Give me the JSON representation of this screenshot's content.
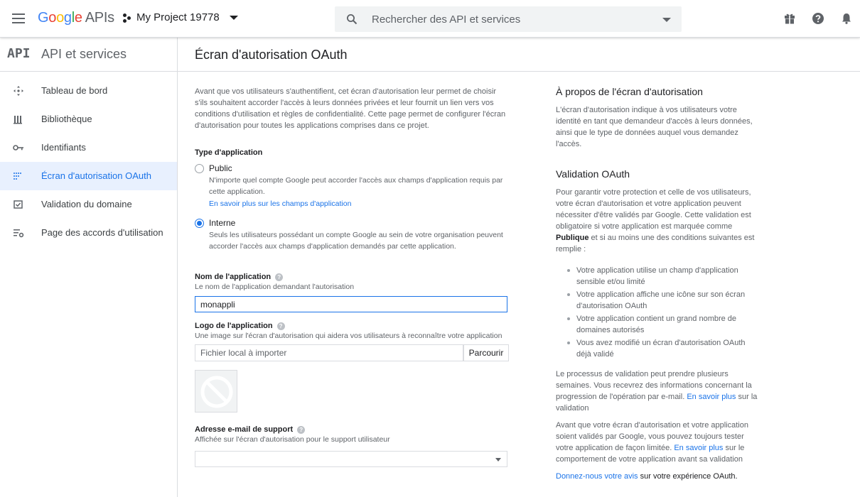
{
  "header": {
    "logo_google": [
      "G",
      "o",
      "o",
      "g",
      "l",
      "e"
    ],
    "logo_apis": "APIs",
    "project_name": "My Project 19778",
    "search_placeholder": "Rechercher des API et services",
    "icons": [
      "menu-icon",
      "project-icon",
      "search-icon",
      "gift-icon",
      "help-icon",
      "notifications-icon"
    ]
  },
  "sidebar": {
    "badge": "API",
    "title": "API et services",
    "items": [
      {
        "label": "Tableau de bord",
        "icon": "dashboard-icon"
      },
      {
        "label": "Bibliothèque",
        "icon": "library-icon"
      },
      {
        "label": "Identifiants",
        "icon": "key-icon"
      },
      {
        "label": "Écran d'autorisation OAuth",
        "icon": "oauth-consent-icon",
        "active": true
      },
      {
        "label": "Validation du domaine",
        "icon": "domain-verification-icon"
      },
      {
        "label": "Page des accords d'utilisation",
        "icon": "agreements-icon"
      }
    ]
  },
  "main": {
    "title": "Écran d'autorisation OAuth",
    "intro": "Avant que vos utilisateurs s'authentifient, cet écran d'autorisation leur permet de choisir s'ils souhaitent accorder l'accès à leurs données privées et leur fournit un lien vers vos conditions d'utilisation et règles de confidentialité. Cette page permet de configurer l'écran d'autorisation pour toutes les applications comprises dans ce projet.",
    "app_type": {
      "label": "Type d'application",
      "public_title": "Public",
      "public_desc": "N'importe quel compte Google peut accorder l'accès aux champs d'application requis par cette application.",
      "public_link": "En savoir plus sur les champs d'application",
      "internal_title": "Interne",
      "internal_desc": "Seuls les utilisateurs possédant un compte Google au sein de votre organisation peuvent accorder l'accès aux champs d'application demandés par cette application.",
      "selected": "Interne"
    },
    "app_name": {
      "label": "Nom de l'application",
      "desc": "Le nom de l'application demandant l'autorisation",
      "value": "monappli"
    },
    "app_logo": {
      "label": "Logo de l'application",
      "desc": "Une image sur l'écran d'autorisation qui aidera vos utilisateurs à reconnaître votre application",
      "file_placeholder": "Fichier local à importer",
      "browse_label": "Parcourir"
    },
    "support_email": {
      "label": "Adresse e-mail de support",
      "desc": "Affichée sur l'écran d'autorisation pour le support utilisateur",
      "value": ""
    }
  },
  "aside": {
    "about_title": "À propos de l'écran d'autorisation",
    "about_text": "L'écran d'autorisation indique à vos utilisateurs votre identité en tant que demandeur d'accès à leurs données, ainsi que le type de données auquel vous demandez l'accès.",
    "validation_title": "Validation OAuth",
    "validation_text_1": "Pour garantir votre protection et celle de vos utilisateurs, votre écran d'autorisation et votre application peuvent nécessiter d'être validés par Google. Cette validation est obligatoire si votre application est marquée comme ",
    "validation_bold": "Publique",
    "validation_text_2": " et si au moins une des conditions suivantes est remplie :",
    "conditions": [
      "Votre application utilise un champ d'application sensible et/ou limité",
      "Votre application affiche une icône sur son écran d'autorisation OAuth",
      "Votre application contient un grand nombre de domaines autorisés",
      "Vous avez modifié un écran d'autorisation OAuth déjà validé"
    ],
    "process_text": "Le processus de validation peut prendre plusieurs semaines. Vous recevrez des informations concernant la progression de l'opération par e-mail.",
    "process_link": "En savoir plus",
    "process_link_suffix": " sur la validation",
    "test_text": "Avant que votre écran d'autorisation et votre application soient validés par Google, vous pouvez toujours tester votre application de façon limitée. ",
    "test_link": "En savoir plus",
    "test_suffix": " sur le comportement de votre application avant sa validation",
    "feedback_link": "Donnez-nous votre avis",
    "feedback_suffix": " sur votre expérience OAuth."
  },
  "colors": {
    "accent": "#1a73e8",
    "active_bg": "#e8f0fe",
    "muted_text": "#5f6368"
  }
}
